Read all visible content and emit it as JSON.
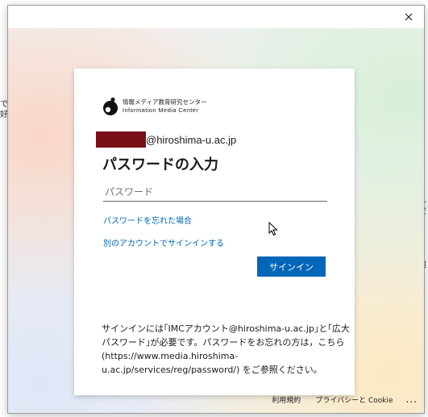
{
  "background": {
    "fragments": [
      "で",
      "好",
      "れば",
      "報"
    ]
  },
  "dialog": {
    "close_icon": "close-icon"
  },
  "card": {
    "logo": {
      "name_ja": "情報メディア教育研究センター",
      "name_en": "Information Media Center"
    },
    "account_suffix": "@hiroshima-u.ac.jp",
    "title": "パスワードの入力",
    "password_placeholder": "パスワード",
    "forgot_link": "パスワードを忘れた場合",
    "other_account_link": "別のアカウントでサインインする",
    "signin_button": "サインイン",
    "notice_lines": [
      "サインインには｢IMCアカウント@hiroshima-u.ac.jp｣と｢広大",
      "パスワード｣が必要です。パスワードをお忘れの方は，こちら",
      "(https://www.media.hiroshima-",
      "u.ac.jp/services/reg/password/) をご参照ください。"
    ]
  },
  "footer": {
    "terms": "利用規約",
    "privacy": "プライバシーと Cookie",
    "more": "..."
  },
  "colors": {
    "accent": "#0067b8",
    "redaction": "#7a0f18"
  }
}
